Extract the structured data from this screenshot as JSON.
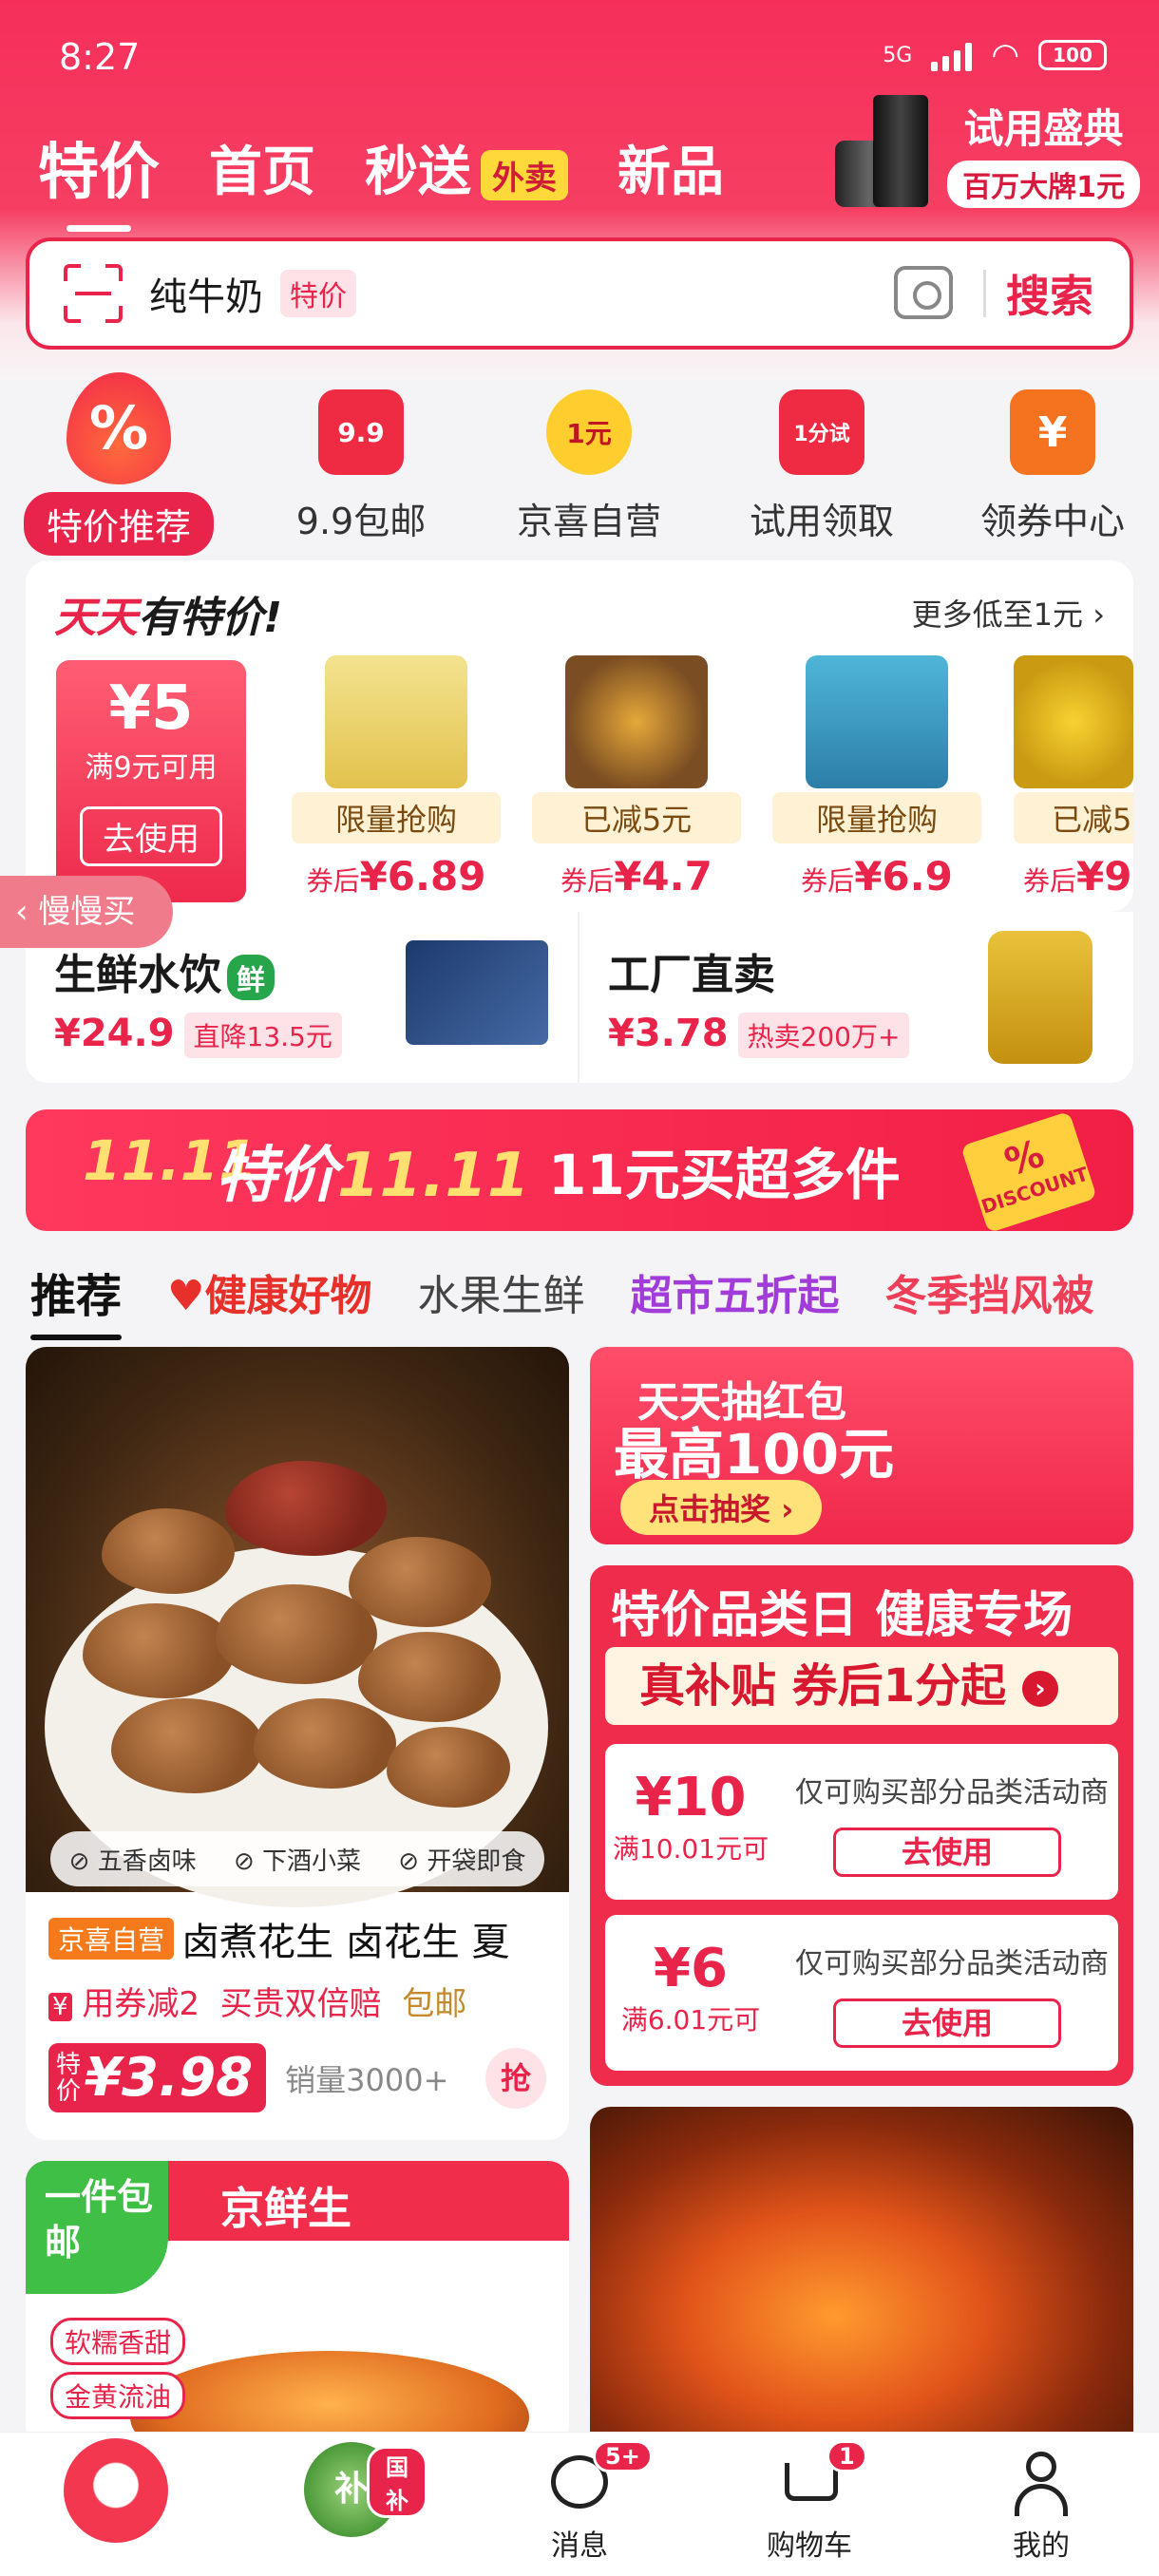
{
  "status_bar": {
    "time": "8:27",
    "network": "5G",
    "battery": "100"
  },
  "header": {
    "tabs": [
      {
        "label": "特价",
        "active": true
      },
      {
        "label": "首页"
      },
      {
        "label": "秒送"
      },
      {
        "label": "新品"
      }
    ],
    "waimai_tag": "外卖",
    "promo_title": "试用盛典",
    "promo_sub": "百万大牌1元",
    "colors": {
      "brand": "#e9244a",
      "header": "#f52f5a"
    }
  },
  "search": {
    "query": "纯牛奶",
    "tag": "特价",
    "button": "搜索",
    "camera_icon": "camera-ai-icon",
    "scan_icon": "scan-icon"
  },
  "categories": [
    {
      "label": "特价推荐",
      "icon": "flame-percent-icon"
    },
    {
      "label": "9.9包邮",
      "icon_text": "9.9"
    },
    {
      "label": "京喜自营",
      "icon_text": "1元"
    },
    {
      "label": "试用领取",
      "icon_text": "1分试"
    },
    {
      "label": "领券中心",
      "icon_text": "¥"
    }
  ],
  "daily": {
    "title_red": "天天",
    "title_black": "有特价!",
    "more": "更多低至1元",
    "coupon": {
      "value": "¥5",
      "cond": "满9元可用",
      "btn": "去使用"
    },
    "products": [
      {
        "label": "限量抢购",
        "prefix": "券后",
        "price": "¥6.89"
      },
      {
        "label": "已减5元",
        "prefix": "券后",
        "price": "¥4.7"
      },
      {
        "label": "限量抢购",
        "prefix": "券后",
        "price": "¥6.9"
      },
      {
        "label": "已减5",
        "prefix": "券后",
        "price": "¥9"
      }
    ]
  },
  "back_button": "慢慢买",
  "subcards": [
    {
      "title": "生鲜水饮",
      "badge": "鲜",
      "price": "¥24.9",
      "tag": "直降13.5元"
    },
    {
      "title": "工厂直卖",
      "price": "¥3.78",
      "tag": "热卖200万+"
    }
  ],
  "banner": {
    "logo": "11.11",
    "title_a": "特价",
    "title_b": "11.11",
    "sub": "11元买超多件",
    "discount": "DISCOUNT"
  },
  "feed_tabs": [
    {
      "label": "推荐",
      "active": true
    },
    {
      "label": "健康好物"
    },
    {
      "label": "水果生鲜"
    },
    {
      "label": "超市五折起"
    },
    {
      "label": "冬季挡风被"
    }
  ],
  "feed_product": {
    "chips": [
      "五香卤味",
      "下酒小菜",
      "开袋即食"
    ],
    "store_tag": "京喜自营",
    "title": "卤煮花生 卤花生 夏",
    "sub1": "用券减2",
    "sub2": "买贵双倍赔",
    "sub3": "包邮",
    "price_tag": "特价",
    "price": "¥3.98",
    "sales": "销量3000+",
    "grab": "抢"
  },
  "red_packet": {
    "line1": "天天抽红包",
    "line2": "最高100元",
    "btn": "点击抽奖"
  },
  "category_day": {
    "title": "特价品类日 健康专场",
    "sub": "真补贴 券后1分起",
    "coupons": [
      {
        "value": "¥10",
        "cond": "满10.01元可",
        "desc": "仅可购买部分品类活动商",
        "btn": "去使用"
      },
      {
        "value": "¥6",
        "cond": "满6.01元可",
        "desc": "仅可购买部分品类活动商",
        "btn": "去使用"
      }
    ]
  },
  "jingxian": {
    "corner": "一件包邮",
    "name": "京鲜生",
    "pills": [
      "软糯香甜",
      "金黄流油"
    ]
  },
  "bottom_nav": [
    {
      "label": "",
      "icon": "jd-mascot-icon"
    },
    {
      "label": "",
      "icon": "subsidy-shield-icon",
      "badge": "国补"
    },
    {
      "label": "消息",
      "icon": "message-icon",
      "badge": "5+"
    },
    {
      "label": "购物车",
      "icon": "cart-icon",
      "badge": "1"
    },
    {
      "label": "我的",
      "icon": "user-icon"
    }
  ]
}
